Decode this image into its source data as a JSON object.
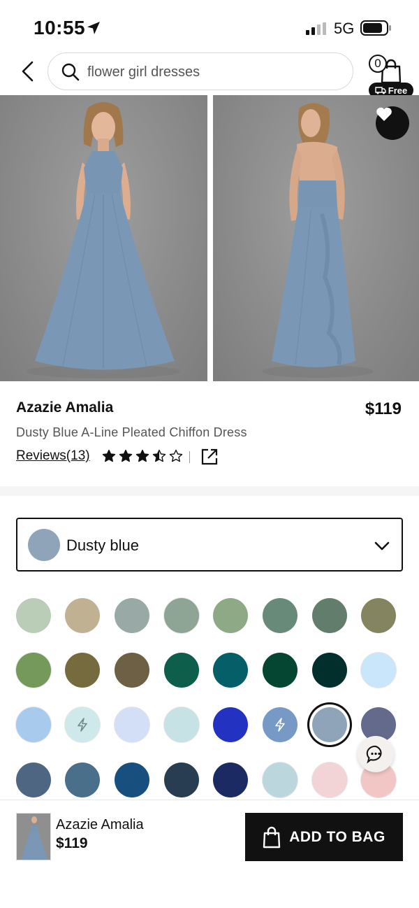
{
  "status_bar": {
    "time": "10:55",
    "network": "5G"
  },
  "header": {
    "search": {
      "value": "flower girl dresses"
    },
    "cart": {
      "count": "0",
      "badge": "Free"
    }
  },
  "gallery": {
    "photos": [
      {
        "alt": "Front view of dusty blue halter A-line dress"
      },
      {
        "alt": "Back view of dusty blue dress with ruffle"
      }
    ]
  },
  "product": {
    "brand": "Azazie Amalia",
    "price": "$119",
    "description": "Dusty Blue A-Line Pleated Chiffon Dress",
    "reviews_label": "Reviews(13)",
    "rating": 3.5,
    "rating_max": 5
  },
  "color_select": {
    "label": "Dusty blue",
    "color": "#8fa4b8"
  },
  "swatches": [
    {
      "color": "#b9cdb7"
    },
    {
      "color": "#bfb192"
    },
    {
      "color": "#99aaa6"
    },
    {
      "color": "#8ea596",
      "ring": true
    },
    {
      "color": "#8ea986"
    },
    {
      "color": "#688a78"
    },
    {
      "color": "#637d6c"
    },
    {
      "color": "#848460"
    },
    {
      "color": "#75995a",
      "ring": true
    },
    {
      "color": "#766b3f"
    },
    {
      "color": "#6e6045"
    },
    {
      "color": "#0e5e4c"
    },
    {
      "color": "#045f69"
    },
    {
      "color": "#054633"
    },
    {
      "color": "#022f2b"
    },
    {
      "color": "#c9e6fa",
      "ring": true
    },
    {
      "color": "#a8cbed",
      "ring": true
    },
    {
      "color": "#cfe9ea",
      "icon": "lightning-icon",
      "ring": true
    },
    {
      "color": "#d3dff6",
      "ring": true
    },
    {
      "color": "#c7e2e4",
      "ring": true
    },
    {
      "color": "#2332c0"
    },
    {
      "color": "#7799c6",
      "icon": "lightning-icon"
    },
    {
      "color": "#8fa4b8",
      "selected": true
    },
    {
      "color": "#636a8c"
    },
    {
      "color": "#4f6683"
    },
    {
      "color": "#4a6f8a"
    },
    {
      "color": "#17507e"
    },
    {
      "color": "#293d52"
    },
    {
      "color": "#1b2a63"
    },
    {
      "color": "#bcd6dd",
      "ring": true
    },
    {
      "color": "#f2d4d7",
      "ring": true
    },
    {
      "color": "#f1c6c5",
      "ring": true
    }
  ],
  "bottom_bar": {
    "name": "Azazie Amalia",
    "price": "$119",
    "add_label": "ADD TO BAG"
  },
  "colors": {
    "primary": "#111111",
    "muted_text": "#555555",
    "photo_bg": "#8a8a8a",
    "dress": "#7a98b6"
  }
}
